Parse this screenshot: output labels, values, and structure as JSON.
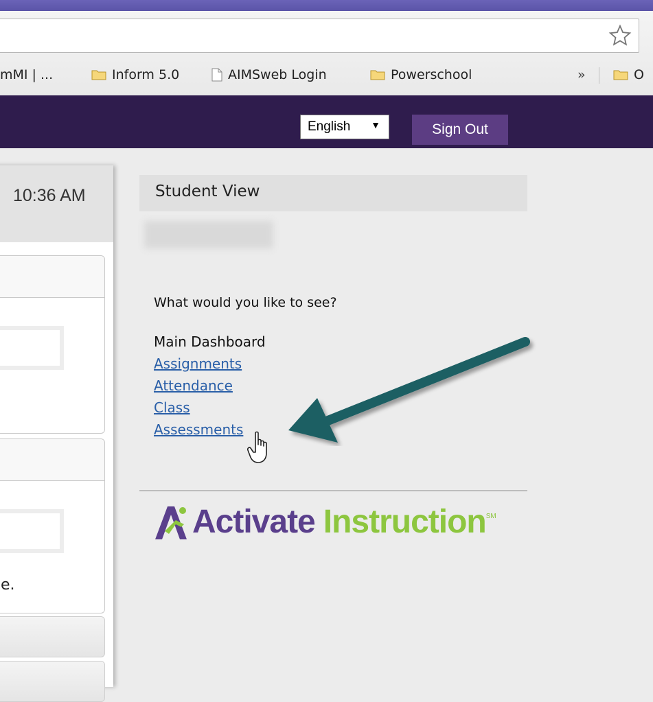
{
  "browser": {
    "bookmarks": [
      {
        "label": "mMI | ...",
        "icon": "none"
      },
      {
        "label": "Inform 5.0",
        "icon": "folder-icon"
      },
      {
        "label": "AIMSweb Login",
        "icon": "page-icon"
      },
      {
        "label": "Powerschool",
        "icon": "folder-icon"
      },
      {
        "label": "O",
        "icon": "folder-icon"
      }
    ],
    "overflow_label": "»"
  },
  "header": {
    "language": "English",
    "sign_out": "Sign Out",
    "background_color": "#2f1c4d",
    "button_color": "#5c3d83"
  },
  "left_panel": {
    "time": "10:36 AM",
    "fragment": "e."
  },
  "student_view": {
    "title": "Student View",
    "prompt": "What would you like to see?",
    "menu": [
      {
        "label": "Main Dashboard",
        "link": false
      },
      {
        "label": "Assignments",
        "link": true
      },
      {
        "label": "Attendance",
        "link": true
      },
      {
        "label": "Class",
        "link": true
      },
      {
        "label": "Assessments",
        "link": true
      }
    ]
  },
  "logo": {
    "word1": "Activate",
    "word2": "Instruction",
    "mark": "SM",
    "color_purple": "#5a3f8c",
    "color_green": "#8dc63f"
  }
}
